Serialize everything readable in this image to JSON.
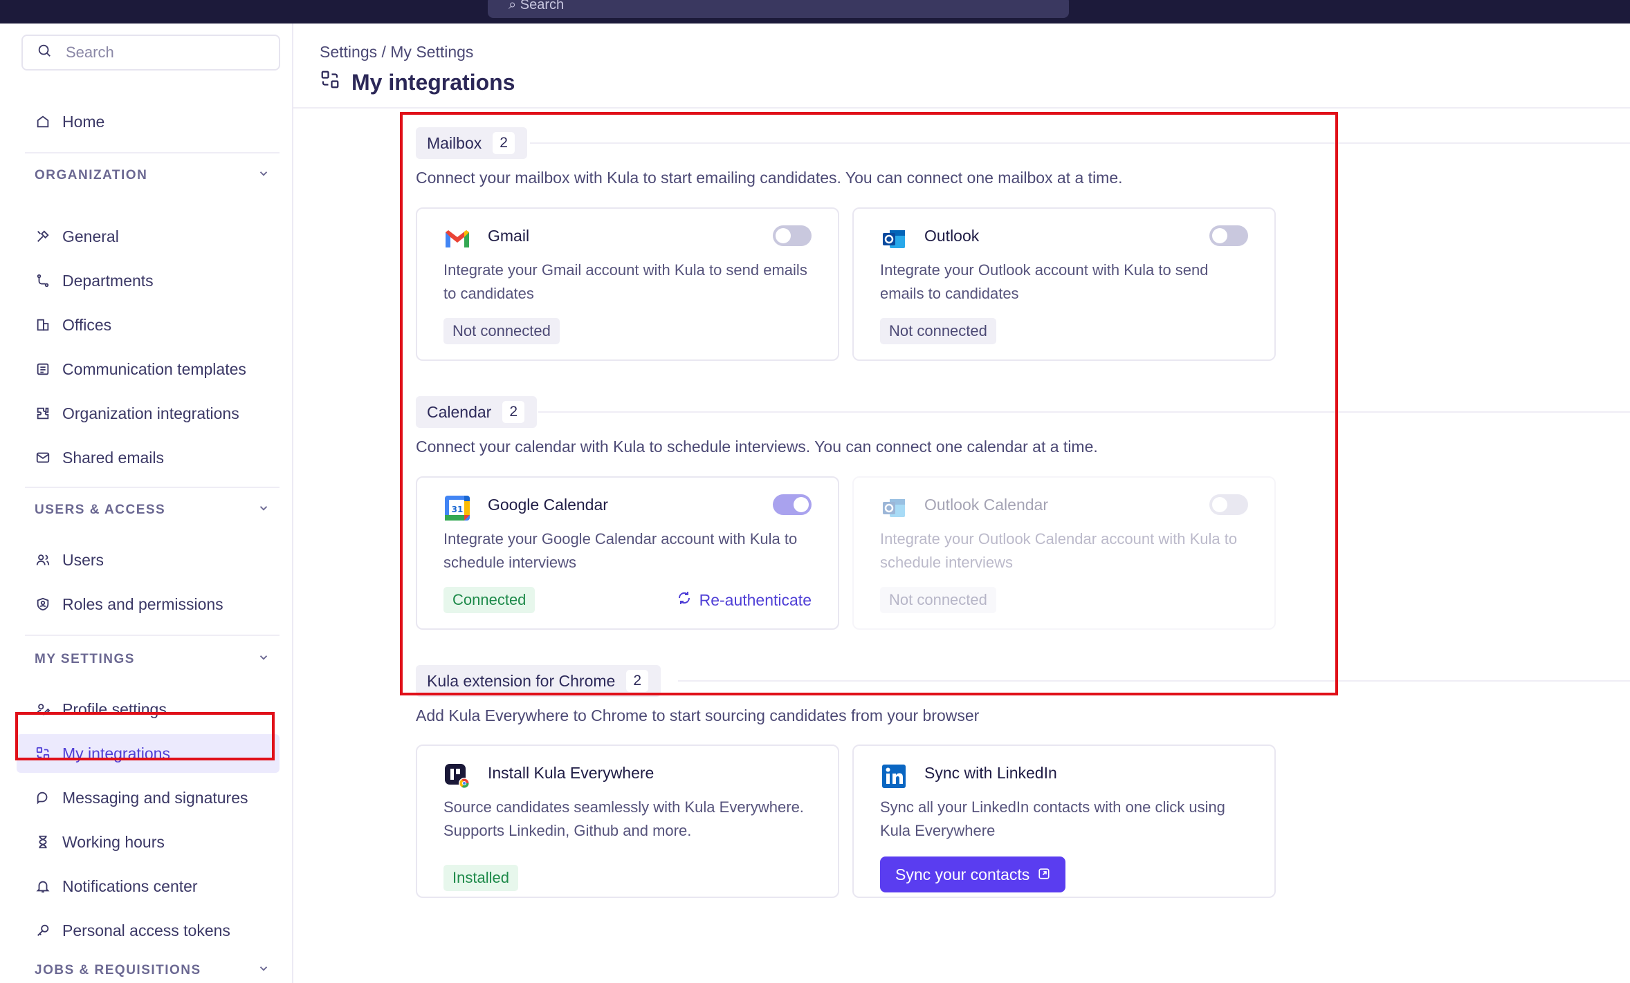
{
  "topbar": {
    "search_placeholder": "Search"
  },
  "sidebar": {
    "search_placeholder": "Search",
    "home": "Home",
    "sections": [
      {
        "title": "ORGANIZATION",
        "items": [
          "General",
          "Departments",
          "Offices",
          "Communication templates",
          "Organization integrations",
          "Shared emails"
        ]
      },
      {
        "title": "USERS & ACCESS",
        "items": [
          "Users",
          "Roles and permissions"
        ]
      },
      {
        "title": "MY SETTINGS",
        "items": [
          "Profile settings",
          "My integrations",
          "Messaging and signatures",
          "Working hours",
          "Notifications center",
          "Personal access tokens"
        ]
      },
      {
        "title": "JOBS & REQUISITIONS"
      }
    ]
  },
  "header": {
    "breadcrumb": "Settings / My Settings",
    "title": "My integrations"
  },
  "mailbox": {
    "label": "Mailbox",
    "count": "2",
    "description": "Connect your mailbox with Kula to start emailing candidates. You can connect one mailbox at a time.",
    "cards": [
      {
        "title": "Gmail",
        "desc": "Integrate your Gmail account with Kula to send emails to candidates",
        "status": "Not connected"
      },
      {
        "title": "Outlook",
        "desc": "Integrate your Outlook account with Kula to send emails to candidates",
        "status": "Not connected"
      }
    ]
  },
  "calendar": {
    "label": "Calendar",
    "count": "2",
    "description": "Connect your calendar with Kula to schedule interviews. You can connect one calendar at a time.",
    "cards": [
      {
        "title": "Google Calendar",
        "desc": "Integrate your Google Calendar account with Kula to schedule interviews",
        "status": "Connected",
        "action": "Re-authenticate"
      },
      {
        "title": "Outlook Calendar",
        "desc": "Integrate your Outlook Calendar account with Kula to schedule interviews",
        "status": "Not connected"
      }
    ]
  },
  "chrome": {
    "label": "Kula extension for Chrome",
    "count": "2",
    "description": "Add Kula Everywhere to Chrome to start sourcing candidates from your browser",
    "cards": [
      {
        "title": "Install Kula Everywhere",
        "desc": "Source candidates seamlessly with Kula Everywhere. Supports Linkedin, Github and more.",
        "status": "Installed"
      },
      {
        "title": "Sync with LinkedIn",
        "desc": "Sync all your LinkedIn contacts with one click using Kula Everywhere",
        "button": "Sync your contacts"
      }
    ]
  },
  "colors": {
    "accent": "#5a3df0",
    "highlight": "#e01019",
    "connected": "#1e8a4a"
  }
}
